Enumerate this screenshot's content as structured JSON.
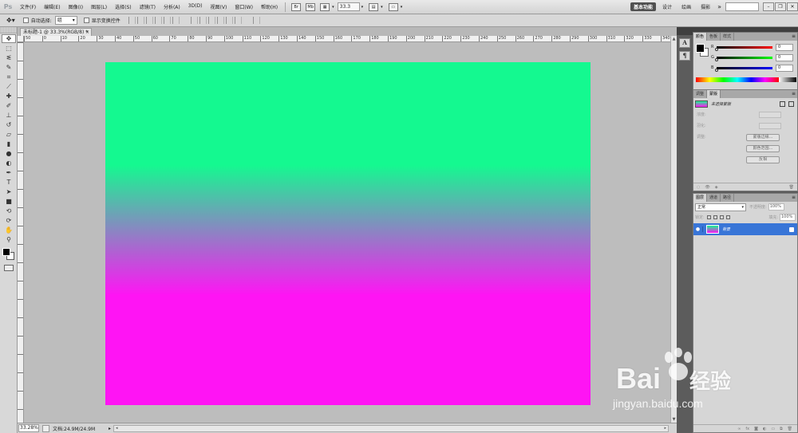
{
  "app": {
    "logo": "Ps"
  },
  "menu": [
    "文件(F)",
    "编辑(E)",
    "图像(I)",
    "图层(L)",
    "选择(S)",
    "滤镜(T)",
    "分析(A)",
    "3D(D)",
    "视图(V)",
    "窗口(W)",
    "帮助(H)"
  ],
  "menubar": {
    "zoom": "33.3",
    "workspaces": [
      "基本功能",
      "设计",
      "绘画",
      "摄影"
    ],
    "more": "»"
  },
  "options": {
    "auto_select_label": "自动选择:",
    "auto_select_value": "组",
    "show_transform_label": "显示变换控件"
  },
  "document": {
    "tab_title": "未标题-1 @ 33.3%(RGB/8) *",
    "ruler_h": [
      "50",
      "0",
      "10",
      "20",
      "30",
      "40",
      "50",
      "60",
      "70",
      "80",
      "90",
      "100",
      "110",
      "120",
      "130",
      "140",
      "150",
      "160",
      "170",
      "180",
      "190",
      "200",
      "210",
      "220",
      "230",
      "240",
      "250",
      "260",
      "270",
      "280",
      "290",
      "300",
      "310",
      "320",
      "330",
      "340"
    ],
    "gradient_top": "#14f990",
    "gradient_bottom": "#ff14f4"
  },
  "status": {
    "zoom": "33.28%",
    "doc_info": "文档:24.9M/24.9M"
  },
  "color_panel": {
    "tabs": [
      "颜色",
      "色板",
      "样式"
    ],
    "channels": [
      {
        "label": "R",
        "value": "0"
      },
      {
        "label": "G",
        "value": "0"
      },
      {
        "label": "B",
        "value": "0"
      }
    ]
  },
  "masks_panel": {
    "tabs": [
      "调整",
      "蒙版"
    ],
    "title": "未选择蒙版",
    "rows": [
      "浓度:",
      "羽化:",
      "调整:"
    ],
    "buttons": [
      "蒙版边缘...",
      "颜色范围...",
      "反相"
    ]
  },
  "layers_panel": {
    "tabs": [
      "图层",
      "通道",
      "路径"
    ],
    "blend_mode": "正常",
    "opacity_label": "不透明度:",
    "opacity_value": "100%",
    "lock_label": "锁定:",
    "fill_label": "填充:",
    "fill_value": "100%",
    "layer_name": "背景"
  },
  "watermark": {
    "brand": "Bai",
    "brand_cn": "经验",
    "url": "jingyan.baidu.com"
  }
}
